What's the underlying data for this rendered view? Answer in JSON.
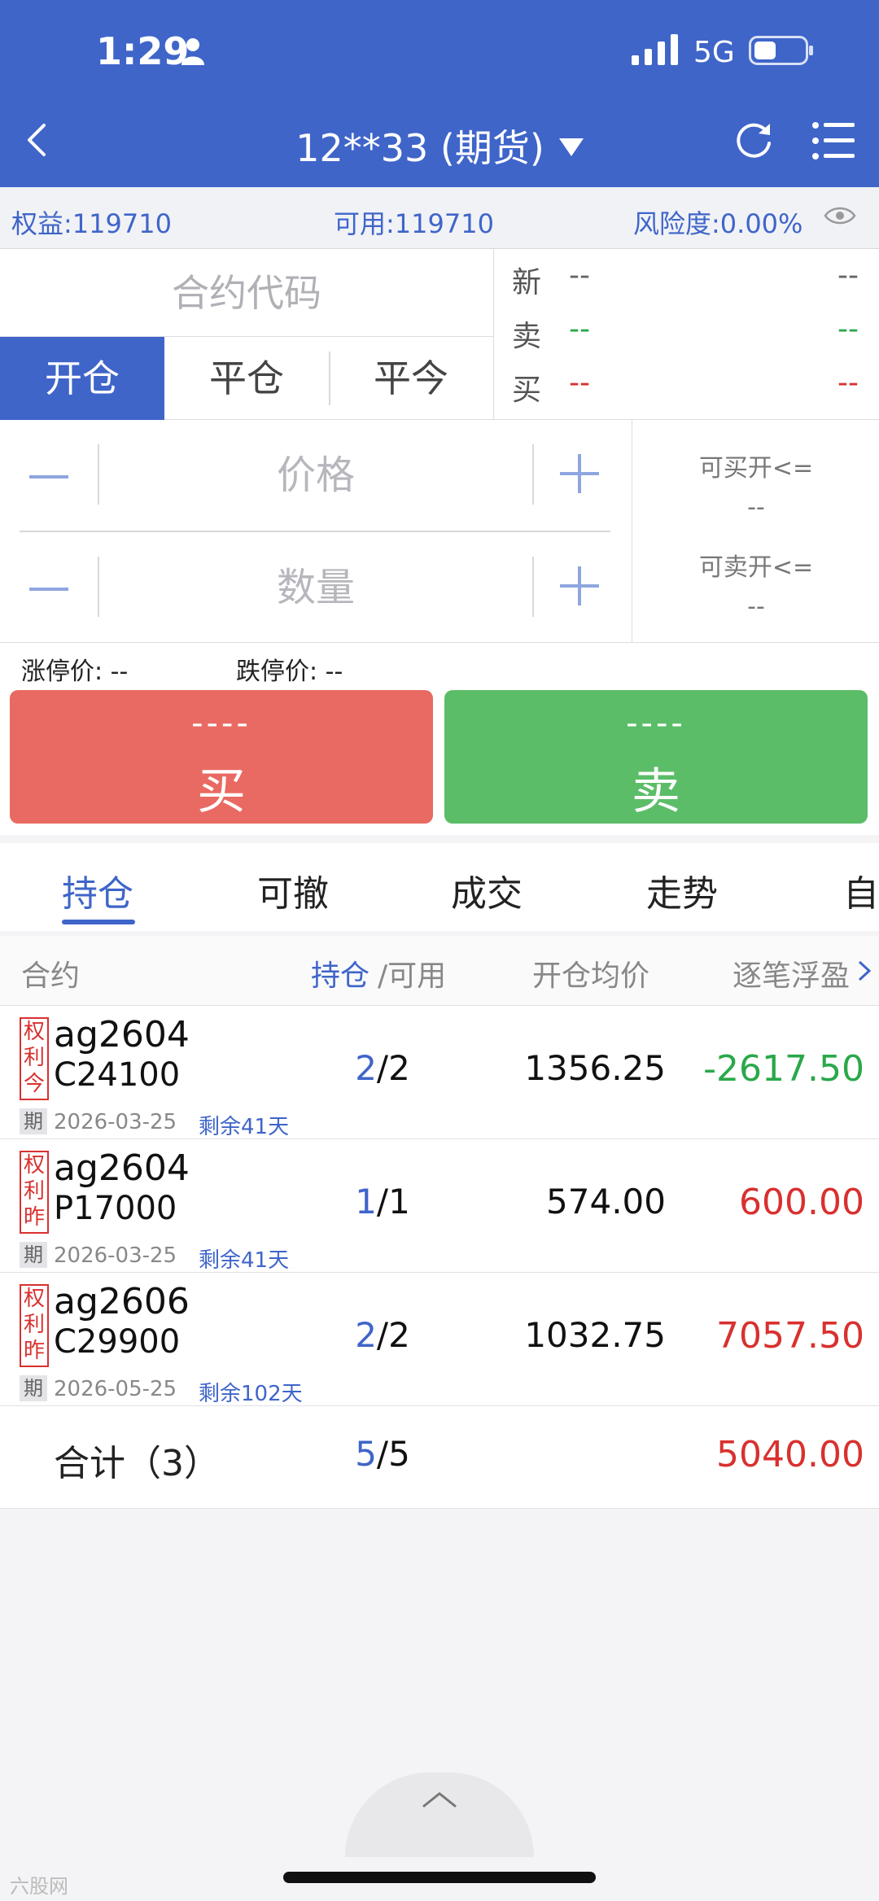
{
  "status_bar": {
    "time": "1:29",
    "network": "5G"
  },
  "header": {
    "account_title": "12**33 (期货)"
  },
  "account": {
    "equity": "权益:119710",
    "available": "可用:119710",
    "risk": "风险度:0.00%"
  },
  "order": {
    "code_placeholder": "合约代码",
    "open_tabs": [
      "开仓",
      "平仓",
      "平今"
    ],
    "quote": {
      "latest_label": "新",
      "latest_value": "--",
      "latest_value2": "--",
      "sell_label": "卖",
      "sell_value": "--",
      "sell_value2": "--",
      "buy_label": "买",
      "buy_value": "--",
      "buy_value2": "--"
    },
    "price_placeholder": "价格",
    "qty_placeholder": "数量",
    "can_buy_label": "可买开<=",
    "can_buy_value": "--",
    "can_sell_label": "可卖开<=",
    "can_sell_value": "--",
    "limit_up": "涨停价: --",
    "limit_down": "跌停价: --",
    "buy_price": "----",
    "buy_label": "买",
    "sell_price": "----",
    "sell_label": "卖"
  },
  "tabs": [
    "持仓",
    "可撤",
    "成交",
    "走势",
    "自"
  ],
  "table": {
    "headers": {
      "contract": "合约",
      "pos": "持仓",
      "avail": "/可用",
      "avg": "开仓均价",
      "pnl": "逐笔浮盈"
    },
    "rows": [
      {
        "tag": [
          "权",
          "利",
          "今"
        ],
        "code1": "ag2604",
        "code2": "C24100",
        "qi": "期",
        "expire": "2026-03-25",
        "remain": "剩余41天",
        "hold": "2",
        "avail": "/2",
        "avg": "1356.25",
        "pnl": "-2617.50"
      },
      {
        "tag": [
          "权",
          "利",
          "昨"
        ],
        "code1": "ag2604",
        "code2": "P17000",
        "qi": "期",
        "expire": "2026-03-25",
        "remain": "剩余41天",
        "hold": "1",
        "avail": "/1",
        "avg": "574.00",
        "pnl": "600.00"
      },
      {
        "tag": [
          "权",
          "利",
          "昨"
        ],
        "code1": "ag2606",
        "code2": "C29900",
        "qi": "期",
        "expire": "2026-05-25",
        "remain": "剩余102天",
        "hold": "2",
        "avail": "/2",
        "avg": "1032.75",
        "pnl": "7057.50"
      }
    ],
    "total": {
      "label": "合计（3）",
      "hold": "5",
      "avail": "/5",
      "pnl": "5040.00"
    }
  },
  "watermark": "六股网",
  "colors": {
    "brand": "#3f65c9",
    "buy": "#e96a62",
    "sell": "#5cbd69",
    "loss": "#2aa84a",
    "gain": "#d8312f"
  },
  "icons": [
    "person-icon",
    "signal-icon",
    "battery-icon",
    "back-icon",
    "caret-down-icon",
    "refresh-icon",
    "menu-icon",
    "eye-icon",
    "minus-icon",
    "plus-icon",
    "chevron-right-icon",
    "chevron-up-icon"
  ]
}
